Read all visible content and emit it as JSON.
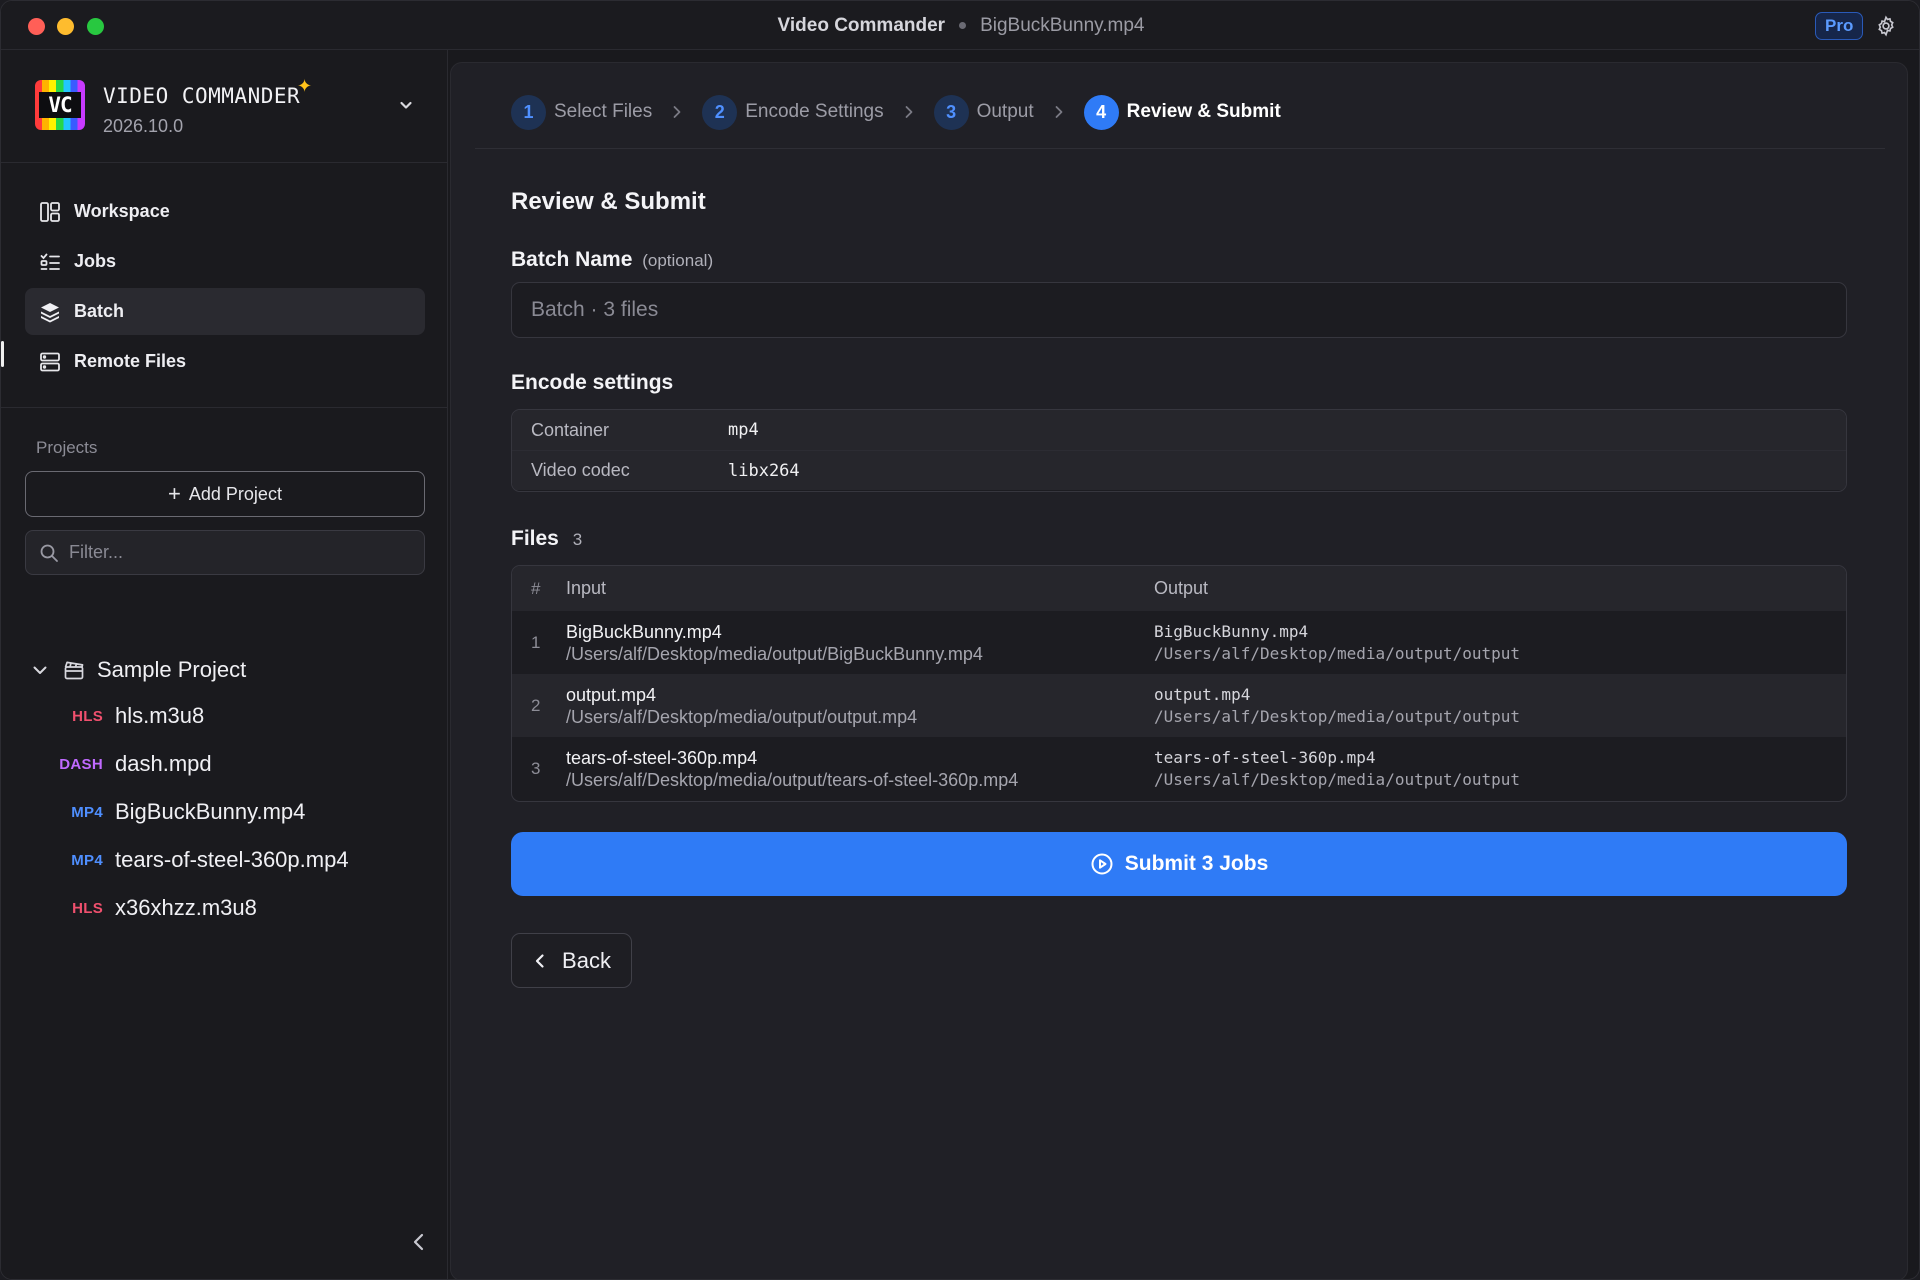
{
  "window": {
    "app_name": "Video Commander",
    "file_name": "BigBuckBunny.mp4",
    "pro_badge": "Pro"
  },
  "sidebar": {
    "brand": {
      "name": "VIDEO COMMANDER",
      "version": "2026.10.0",
      "logo_text": "VC"
    },
    "nav": [
      {
        "label": "Workspace",
        "icon": "workspace-icon"
      },
      {
        "label": "Jobs",
        "icon": "jobs-icon"
      },
      {
        "label": "Batch",
        "icon": "layers-icon",
        "active": true
      },
      {
        "label": "Remote Files",
        "icon": "server-icon"
      }
    ],
    "projects_label": "Projects",
    "add_project_label": "Add Project",
    "filter_placeholder": "Filter...",
    "tree": {
      "root_label": "Sample Project",
      "items": [
        {
          "tag": "HLS",
          "name": "hls.m3u8",
          "tag_color": "#f0506e"
        },
        {
          "tag": "DASH",
          "name": "dash.mpd",
          "tag_color": "#c06aff"
        },
        {
          "tag": "MP4",
          "name": "BigBuckBunny.mp4",
          "tag_color": "#4f8fff"
        },
        {
          "tag": "MP4",
          "name": "tears-of-steel-360p.mp4",
          "tag_color": "#4f8fff"
        },
        {
          "tag": "HLS",
          "name": "x36xhzz.m3u8",
          "tag_color": "#f0506e"
        }
      ]
    }
  },
  "wizard": {
    "steps": [
      {
        "num": "1",
        "label": "Select Files"
      },
      {
        "num": "2",
        "label": "Encode Settings"
      },
      {
        "num": "3",
        "label": "Output"
      },
      {
        "num": "4",
        "label": "Review & Submit",
        "current": true
      }
    ]
  },
  "review": {
    "title": "Review & Submit",
    "batch_name_label": "Batch Name",
    "batch_name_optional": "(optional)",
    "batch_name_placeholder": "Batch · 3 files",
    "batch_name_value": "",
    "encode_title": "Encode settings",
    "encode_settings": [
      {
        "key": "Container",
        "value": "mp4"
      },
      {
        "key": "Video codec",
        "value": "libx264"
      }
    ],
    "files_title": "Files",
    "files_count": "3",
    "files_headers": {
      "num": "#",
      "input": "Input",
      "output": "Output"
    },
    "files": [
      {
        "num": "1",
        "input_name": "BigBuckBunny.mp4",
        "input_path": "/Users/alf/Desktop/media/output/BigBuckBunny.mp4",
        "output_name": "BigBuckBunny.mp4",
        "output_path": "/Users/alf/Desktop/media/output/output"
      },
      {
        "num": "2",
        "input_name": "output.mp4",
        "input_path": "/Users/alf/Desktop/media/output/output.mp4",
        "output_name": "output.mp4",
        "output_path": "/Users/alf/Desktop/media/output/output"
      },
      {
        "num": "3",
        "input_name": "tears-of-steel-360p.mp4",
        "input_path": "/Users/alf/Desktop/media/output/tears-of-steel-360p.mp4",
        "output_name": "tears-of-steel-360p.mp4",
        "output_path": "/Users/alf/Desktop/media/output/output"
      }
    ],
    "submit_label": "Submit 3 Jobs",
    "back_label": "Back"
  },
  "colors": {
    "accent": "#2f7bf6",
    "background": "#19191d",
    "panel": "#202026"
  }
}
